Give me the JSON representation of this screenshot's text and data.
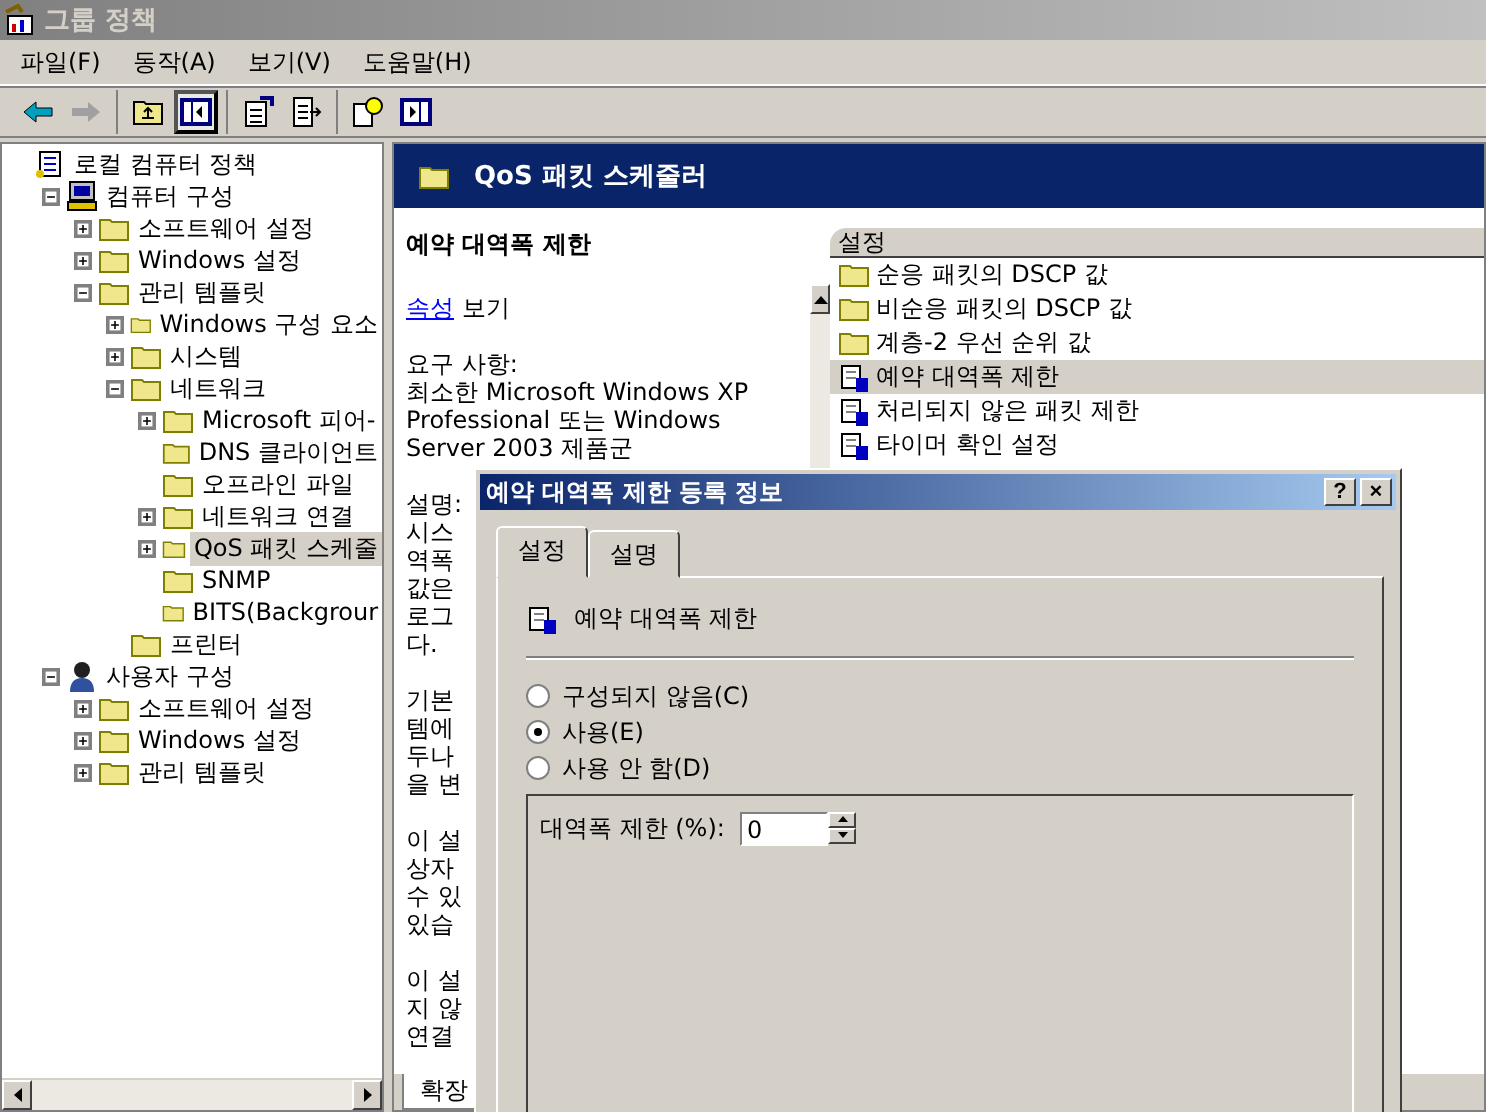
{
  "window": {
    "title": "그룹 정책"
  },
  "menu": [
    "파일(F)",
    "동작(A)",
    "보기(V)",
    "도움말(H)"
  ],
  "toolbar": [
    [
      {
        "kind": "back",
        "disabled": false
      },
      {
        "kind": "forward",
        "disabled": true
      }
    ],
    [
      {
        "kind": "up",
        "pressed": false
      },
      {
        "kind": "tree",
        "pressed": true
      }
    ],
    [
      {
        "kind": "properties",
        "pressed": false
      },
      {
        "kind": "export",
        "pressed": false
      }
    ],
    [
      {
        "kind": "help",
        "pressed": false
      },
      {
        "kind": "console",
        "pressed": false
      }
    ]
  ],
  "tree": [
    {
      "label": "로컬 컴퓨터 정책",
      "kind": "policy",
      "selected": false,
      "children": [
        {
          "label": "컴퓨터 구성",
          "kind": "computer",
          "expanded": true,
          "selected": false,
          "children": [
            {
              "label": "소프트웨어 설정",
              "kind": "folder",
              "expanded": false,
              "selected": false
            },
            {
              "label": "Windows 설정",
              "kind": "folder",
              "expanded": false,
              "selected": false
            },
            {
              "label": "관리 템플릿",
              "kind": "folder",
              "expanded": true,
              "selected": false,
              "children": [
                {
                  "label": "Windows 구성 요소",
                  "kind": "folder",
                  "expanded": false,
                  "selected": false
                },
                {
                  "label": "시스템",
                  "kind": "folder",
                  "expanded": false,
                  "selected": false
                },
                {
                  "label": "네트워크",
                  "kind": "folder",
                  "expanded": true,
                  "selected": false,
                  "children": [
                    {
                      "label": "Microsoft 피어-",
                      "kind": "folder",
                      "expanded": false,
                      "selected": false
                    },
                    {
                      "label": "DNS 클라이언트",
                      "kind": "folder",
                      "selected": false
                    },
                    {
                      "label": "오프라인 파일",
                      "kind": "folder",
                      "selected": false
                    },
                    {
                      "label": "네트워크 연결",
                      "kind": "folder",
                      "expanded": false,
                      "selected": false
                    },
                    {
                      "label": "QoS 패킷 스케줄",
                      "kind": "folder",
                      "expanded": false,
                      "selected": true
                    },
                    {
                      "label": "SNMP",
                      "kind": "folder",
                      "selected": false
                    },
                    {
                      "label": "BITS(Backgrour",
                      "kind": "folder",
                      "selected": false
                    }
                  ]
                },
                {
                  "label": "프린터",
                  "kind": "folder",
                  "selected": false
                }
              ]
            }
          ]
        },
        {
          "label": "사용자 구성",
          "kind": "user",
          "expanded": true,
          "selected": false,
          "children": [
            {
              "label": "소프트웨어 설정",
              "kind": "folder",
              "expanded": false,
              "selected": false
            },
            {
              "label": "Windows 설정",
              "kind": "folder",
              "expanded": false,
              "selected": false
            },
            {
              "label": "관리 템플릿",
              "kind": "folder",
              "expanded": false,
              "selected": false
            }
          ]
        }
      ]
    }
  ],
  "details": {
    "header": "QoS 패킷 스케줄러",
    "title": "예약 대역폭 제한",
    "link": "속성",
    "link_rest": "보기",
    "requirements": [
      "요구 사항:",
      "최소한 Microsoft Windows XP",
      "Professional 또는 Windows",
      "Server 2003 제품군"
    ],
    "description": [
      [
        "설명:",
        "시스",
        "역폭",
        "값은",
        "로그",
        "다."
      ],
      [
        "기본",
        "템에",
        "두나",
        "을 변"
      ],
      [
        "이 설",
        "상자",
        "수 있",
        "있습"
      ],
      [
        "이 설",
        "지 않",
        "연결"
      ]
    ]
  },
  "list": {
    "columns": [
      "설정"
    ],
    "rows": [
      {
        "kind": "folder",
        "label": "순응 패킷의 DSCP 값",
        "selected": false
      },
      {
        "kind": "folder",
        "label": "비순응 패킷의 DSCP 값",
        "selected": false
      },
      {
        "kind": "folder",
        "label": "계층-2 우선 순위 값",
        "selected": false
      },
      {
        "kind": "setting",
        "label": "예약 대역폭 제한",
        "selected": true
      },
      {
        "kind": "setting",
        "label": "처리되지 않은 패킷 제한",
        "selected": false
      },
      {
        "kind": "setting",
        "label": "타이머 확인 설정",
        "selected": false
      }
    ]
  },
  "bottom_tabs": [
    {
      "label": "확장",
      "selected": true
    }
  ],
  "dialog": {
    "title": "예약 대역폭 제한 등록 정보",
    "buttons": [
      "?",
      "×"
    ],
    "tabs": [
      {
        "label": "설정",
        "selected": true
      },
      {
        "label": "설명",
        "selected": false
      }
    ],
    "setting_name": "예약 대역폭 제한",
    "options": [
      {
        "label": "구성되지 않음(C)",
        "selected": false
      },
      {
        "label": "사용(E)",
        "selected": true
      },
      {
        "label": "사용 안 함(D)",
        "selected": false
      }
    ],
    "field": {
      "label": "대역폭 제한 (%):",
      "value": "0"
    }
  }
}
